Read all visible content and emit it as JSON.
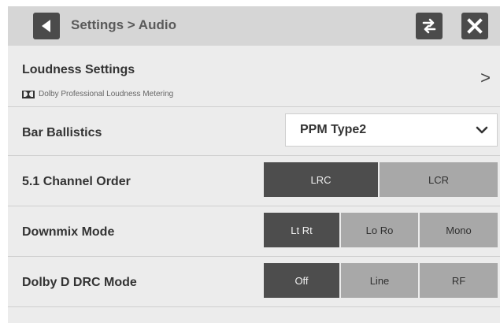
{
  "header": {
    "breadcrumb": "Settings > Audio",
    "back_icon": "back-arrow-icon",
    "swap_icon": "swap-arrows-icon",
    "close_icon": "close-icon"
  },
  "loudness": {
    "label": "Loudness Settings",
    "sub_label": "Dolby Professional Loudness Metering",
    "chevron": ">"
  },
  "bar_ballistics": {
    "label": "Bar Ballistics",
    "value": "PPM Type2"
  },
  "channel_order": {
    "label": "5.1 Channel Order",
    "options": [
      "LRC",
      "LCR"
    ],
    "selected": "LRC"
  },
  "downmix": {
    "label": "Downmix Mode",
    "options": [
      "Lt Rt",
      "Lo Ro",
      "Mono"
    ],
    "selected": "Lt Rt"
  },
  "drc": {
    "label": "Dolby D DRC Mode",
    "options": [
      "Off",
      "Line",
      "RF"
    ],
    "selected": "Off"
  },
  "colors": {
    "selected_bg": "#4d4d4d",
    "unselected_bg": "#a8a8a8",
    "panel_bg": "#ececec"
  }
}
